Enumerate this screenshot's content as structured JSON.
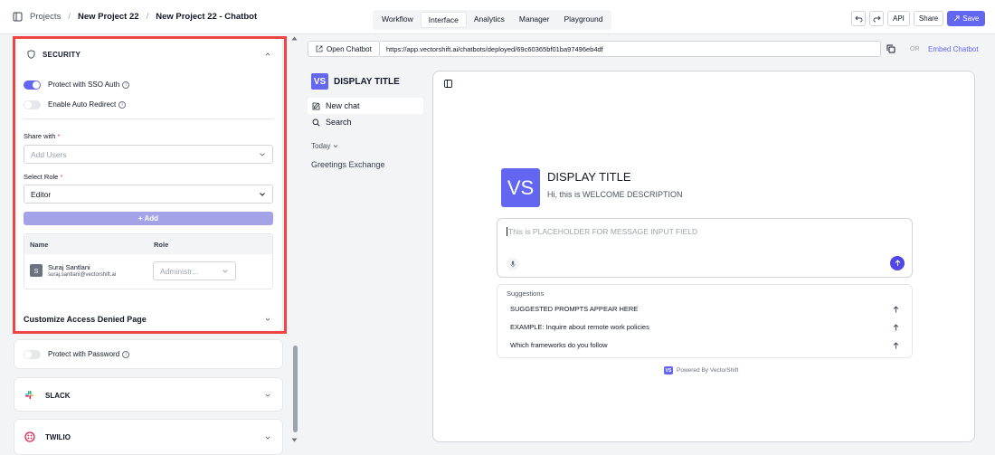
{
  "breadcrumb": {
    "projects": "Projects",
    "project": "New Project 22",
    "page": "New Project 22 - Chatbot",
    "sep": "/"
  },
  "tabs": [
    "Workflow",
    "Interface",
    "Analytics",
    "Manager",
    "Playground"
  ],
  "active_tab": "Interface",
  "toolbar": {
    "api": "API",
    "share": "Share",
    "save": "Save"
  },
  "security": {
    "title": "SECURITY",
    "sso_label": "Protect with SSO Auth",
    "sso_on": true,
    "redirect_label": "Enable Auto Redirect",
    "redirect_on": false,
    "share_with_label": "Share with",
    "share_placeholder": "Add Users",
    "role_label": "Select Role",
    "role_value": "Editor",
    "add_button": "+ Add",
    "table": {
      "col_name": "Name",
      "col_role": "Role",
      "user_initial": "S",
      "user_name": "Suraj Santlani",
      "user_email": "suraj.santlani@vectorshift.ai",
      "user_role": "Administr..."
    },
    "customize": "Customize Access Denied Page",
    "required_mark": "*"
  },
  "password_label": "Protect with Password",
  "slack_label": "SLACK",
  "twilio_label": "TWILIO",
  "url_bar": {
    "open_chatbot": "Open Chatbot",
    "url": "https://app.vectorshift.ai/chatbots/deployed/69c60365bf01ba97496eb4df",
    "or": "OR",
    "embed": "Embed Chatbot"
  },
  "chat_sidebar": {
    "logo": "VS",
    "title": "DISPLAY TITLE",
    "new_chat": "New chat",
    "search": "Search",
    "today": "Today",
    "history": [
      "Greetings Exchange"
    ]
  },
  "chat": {
    "logo": "VS",
    "title": "DISPLAY TITLE",
    "welcome": "Hi, this is WELCOME DESCRIPTION",
    "placeholder": "This is PLACEHOLDER FOR MESSAGE INPUT FIELD",
    "suggestions_title": "Suggestions",
    "suggestions": [
      "SUGGESTED PROMPTS APPEAR HERE",
      "EXAMPLE: Inquire about remote work policies",
      "Which frameworks do you follow"
    ],
    "powered_logo": "VS",
    "powered": "Powered By VectorShift"
  },
  "colors": {
    "accent": "#6366f1",
    "highlight": "#ef4444"
  }
}
